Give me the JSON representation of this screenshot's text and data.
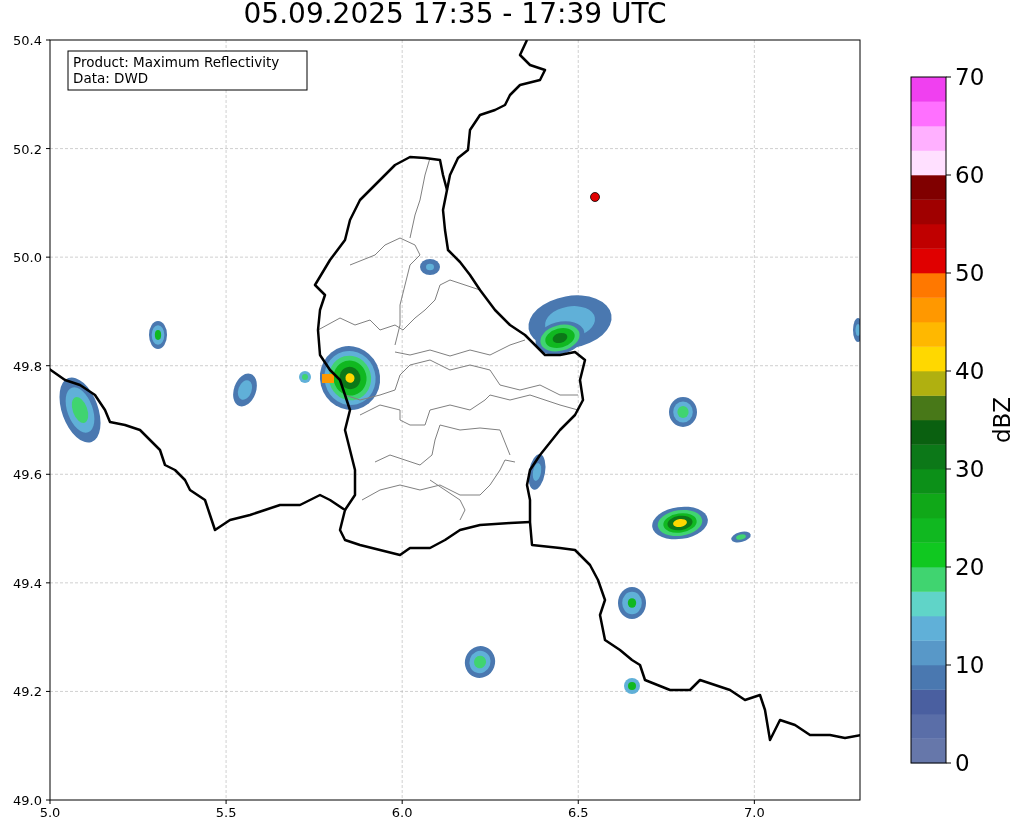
{
  "title": "05.09.2025 17:35 - 17:39 UTC",
  "annotation": [
    "Product: Maximum Reflectivity",
    "Data: DWD"
  ],
  "map": {
    "x_ticks": [
      "5.0",
      "5.5",
      "6.0",
      "6.5",
      "7.0"
    ],
    "y_ticks": [
      "50.4",
      "50.2",
      "50.0",
      "49.8",
      "49.6",
      "49.4",
      "49.2",
      "49.0"
    ]
  },
  "colorbar": {
    "label": "dBZ",
    "ticks": [
      "70",
      "60",
      "50",
      "40",
      "30",
      "20",
      "10",
      "0"
    ],
    "bands": [
      {
        "color": "#6677aa"
      },
      {
        "color": "#5a6ea8"
      },
      {
        "color": "#4a5fa0"
      },
      {
        "color": "#4a78b0"
      },
      {
        "color": "#5898c8"
      },
      {
        "color": "#60b0d8"
      },
      {
        "color": "#60d4c8"
      },
      {
        "color": "#40d470"
      },
      {
        "color": "#10c820"
      },
      {
        "color": "#10b820"
      },
      {
        "color": "#10a818"
      },
      {
        "color": "#0c9018"
      },
      {
        "color": "#0c7818"
      },
      {
        "color": "#0a6010"
      },
      {
        "color": "#487818"
      },
      {
        "color": "#b0b010"
      },
      {
        "color": "#ffd800"
      },
      {
        "color": "#ffb800"
      },
      {
        "color": "#ff9800"
      },
      {
        "color": "#ff7800"
      },
      {
        "color": "#e00000"
      },
      {
        "color": "#c00000"
      },
      {
        "color": "#a00000"
      },
      {
        "color": "#800000"
      },
      {
        "color": "#ffe0ff"
      },
      {
        "color": "#ffb0ff"
      },
      {
        "color": "#ff70ff"
      },
      {
        "color": "#f040f0"
      }
    ]
  }
}
